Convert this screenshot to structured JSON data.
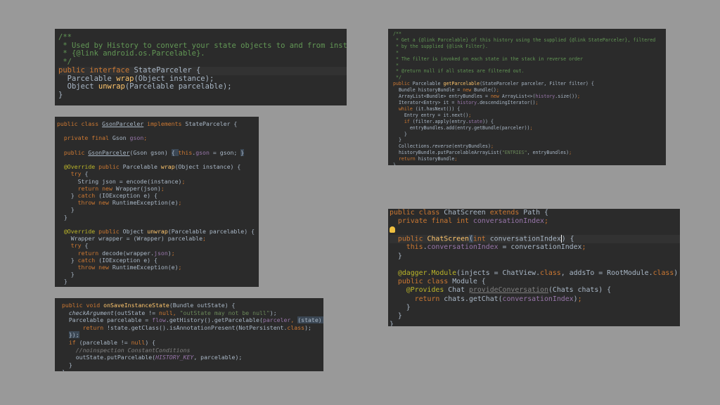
{
  "panel1": {
    "lines": [
      [
        "/**"
      ],
      [
        " * Used by History to convert your state objects to and from instances of"
      ],
      [
        " * {@link android.os.Parcelable}."
      ],
      [
        " */"
      ],
      [
        "public interface ",
        "StateParceler",
        " {"
      ],
      [
        "  Parcelable ",
        "wrap",
        "(Object instance);"
      ],
      [
        "  Object ",
        "unwrap",
        "(Parcelable parcelable);"
      ],
      [
        "}"
      ]
    ]
  },
  "panel2": {
    "lines": [
      [
        "public class ",
        "GsonParceler",
        " implements ",
        "StateParceler {"
      ],
      [
        ""
      ],
      [
        "  private final ",
        "Gson ",
        "gson",
        ";"
      ],
      [
        ""
      ],
      [
        "  public ",
        "GsonParceler",
        "(Gson gson) ",
        "{ ",
        "this",
        ".",
        "gson",
        " = gson; ",
        "}"
      ],
      [
        ""
      ],
      [
        "  @Override ",
        "public ",
        "Parcelable ",
        "wrap",
        "(Object instance) {"
      ],
      [
        "    try ",
        "{"
      ],
      [
        "      String json = encode(instance)",
        ";"
      ],
      [
        "      return new ",
        "Wrapper(json)",
        ";"
      ],
      [
        "    } ",
        "catch ",
        "(IOException e) {"
      ],
      [
        "      throw new ",
        "RuntimeException(e)",
        ";"
      ],
      [
        "    }"
      ],
      [
        "  }"
      ],
      [
        ""
      ],
      [
        "  @Override ",
        "public ",
        "Object ",
        "unwrap",
        "(Parcelable parcelable) {"
      ],
      [
        "    Wrapper wrapper = (Wrapper) parcelable",
        ";"
      ],
      [
        "    try ",
        "{"
      ],
      [
        "      return ",
        "decode(wrapper.",
        "json",
        ")",
        ";"
      ],
      [
        "    } ",
        "catch ",
        "(IOException e) {"
      ],
      [
        "      throw new ",
        "RuntimeException(e)",
        ";"
      ],
      [
        "    }"
      ],
      [
        "  }"
      ],
      [
        "}"
      ]
    ]
  },
  "panel3": {
    "lines": [
      [
        "public void ",
        "onSaveInstanceState",
        "(Bundle outState) {"
      ],
      [
        "  ",
        "checkArgument",
        "(outState != ",
        "null",
        ", ",
        "\"outState may not be null\"",
        ");"
      ],
      [
        "  Parcelable parcelable = ",
        "flow",
        ".getHistory().getParcelable(",
        "parceler",
        ", ",
        "(state) -> {"
      ],
      [
        "      return ",
        "!state.getClass().isAnnotationPresent(NotPersistent.",
        "class",
        ");"
      ],
      [
        "  ",
        "});"
      ],
      [
        "  if ",
        "(parcelable != ",
        "null",
        ") {"
      ],
      [
        "    //noinspection ConstantConditions"
      ],
      [
        "    outState.putParcelable(",
        "HISTORY_KEY",
        ", parcelable);"
      ],
      [
        "  }"
      ],
      [
        "}"
      ]
    ]
  },
  "panel4": {
    "lines": [
      [
        "/**"
      ],
      [
        " * Get a {@link Parcelable} of this history using the supplied {@link StateParceler}, filtered"
      ],
      [
        " * by the supplied {@link Filter}."
      ],
      [
        " *"
      ],
      [
        " * The filter is invoked on each state in the stack in reverse order"
      ],
      [
        " *"
      ],
      [
        " * @return null if all states are filtered out."
      ],
      [
        " */"
      ],
      [
        "public ",
        "Parcelable ",
        "getParcelable",
        "(StateParceler parceler, Filter filter) {"
      ],
      [
        "  Bundle historyBundle = ",
        "new ",
        "Bundle()",
        ";"
      ],
      [
        "  ArrayList<Bundle> entryBundles = ",
        "new ",
        "ArrayList<>(",
        "history",
        ".size())",
        ";"
      ],
      [
        "  Iterator<Entry> it = ",
        "history",
        ".descendingIterator()",
        ";"
      ],
      [
        "  while ",
        "(it.hasNext()) {"
      ],
      [
        "    Entry entry = it.next()",
        ";"
      ],
      [
        "    if ",
        "(filter.apply(entry.",
        "state",
        ")) {"
      ],
      [
        "      entryBundles.add(entry.getBundle(parceler))",
        ";"
      ],
      [
        "    }"
      ],
      [
        "  }"
      ],
      [
        "  Collections.",
        "reverse",
        "(entryBundles)",
        ";"
      ],
      [
        "  historyBundle.putParcelableArrayList(",
        "\"ENTRIES\"",
        ", entryBundles)",
        ";"
      ],
      [
        "  return ",
        "historyBundle",
        ";"
      ],
      [
        "}"
      ]
    ]
  },
  "panel5": {
    "lines": [
      [
        "public class ",
        "ChatScreen ",
        "extends ",
        "Path {"
      ],
      [
        "  private final int ",
        "conversationIndex",
        ";"
      ],
      [
        ""
      ],
      [
        "  public ",
        "ChatScreen",
        "(",
        "int ",
        "conversationIndex",
        ") {"
      ],
      [
        "    this",
        ".",
        "conversationIndex",
        " = conversationIndex",
        ";"
      ],
      [
        "  }"
      ],
      [
        ""
      ],
      [
        "  ",
        "@dagger.Module",
        "(injects = ChatView.",
        "class",
        ", ",
        "addsTo",
        " = RootModule.",
        "class",
        ")"
      ],
      [
        "  public class ",
        "Module {"
      ],
      [
        "    ",
        "@Provides ",
        "Chat ",
        "provideConversation",
        "(Chats chats) {"
      ],
      [
        "      return ",
        "chats.getChat(",
        "conversationIndex",
        ")",
        ";"
      ],
      [
        "    }"
      ],
      [
        "  }"
      ],
      [
        "}"
      ]
    ]
  }
}
